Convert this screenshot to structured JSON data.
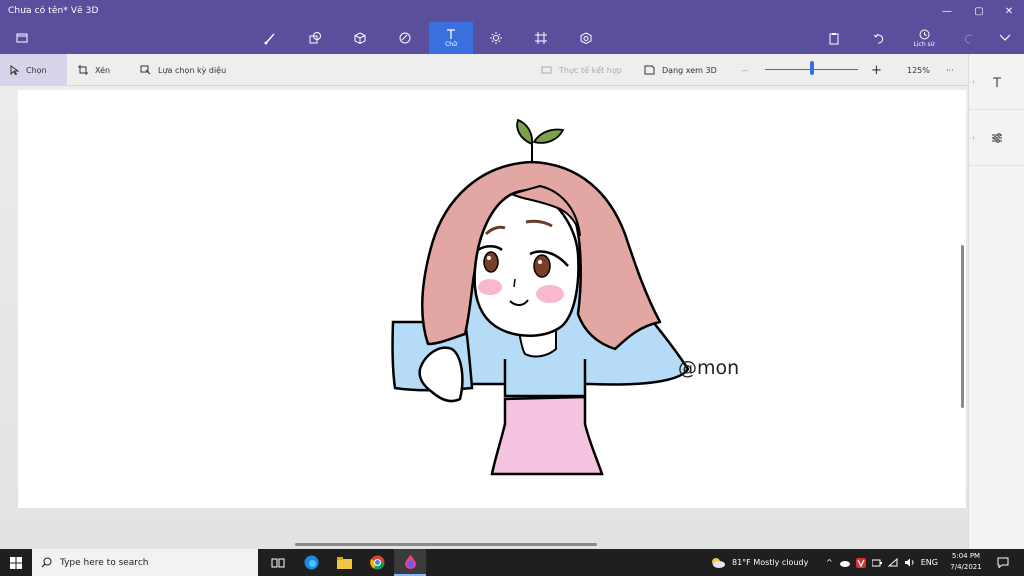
{
  "window": {
    "title": "Chưa có tên*   Vẽ 3D",
    "controls": {
      "minimize": "—",
      "restore": "▢",
      "close": "✕"
    }
  },
  "ribbon": {
    "tools": [
      {
        "icon": "brush-icon",
        "label": ""
      },
      {
        "icon": "shapes-2d-icon",
        "label": ""
      },
      {
        "icon": "shapes-3d-icon",
        "label": ""
      },
      {
        "icon": "stickers-icon",
        "label": ""
      },
      {
        "icon": "text-icon",
        "label": "Chữ",
        "active": true
      },
      {
        "icon": "effects-icon",
        "label": ""
      },
      {
        "icon": "canvas-icon",
        "label": ""
      },
      {
        "icon": "library-3d-icon",
        "label": ""
      }
    ],
    "history_label": "Lịch sử"
  },
  "subbar": {
    "select": "Chọn",
    "crop": "Xén",
    "magic_select": "Lựa chọn kỳ diệu",
    "mixed_reality": "Thực tế kết hợp",
    "view_3d": "Dạng xem 3D",
    "zoom_minus": "—",
    "zoom_plus": "+",
    "zoom_level": "125%",
    "more": "···",
    "zoom_fraction": 0.5
  },
  "canvas": {
    "signature": "@mon"
  },
  "taskbar": {
    "search_placeholder": "Type here to search",
    "weather": "81°F  Mostly cloudy",
    "language": "ENG",
    "time": "5:04 PM",
    "date": "7/4/2021"
  },
  "colors": {
    "accent": "#5a4f9d",
    "active_tool": "#3a6fe0",
    "hair": "#e2a7a3",
    "shirt": "#b5dbf7",
    "apron": "#f4c3df",
    "leaf": "#7ba14a"
  }
}
